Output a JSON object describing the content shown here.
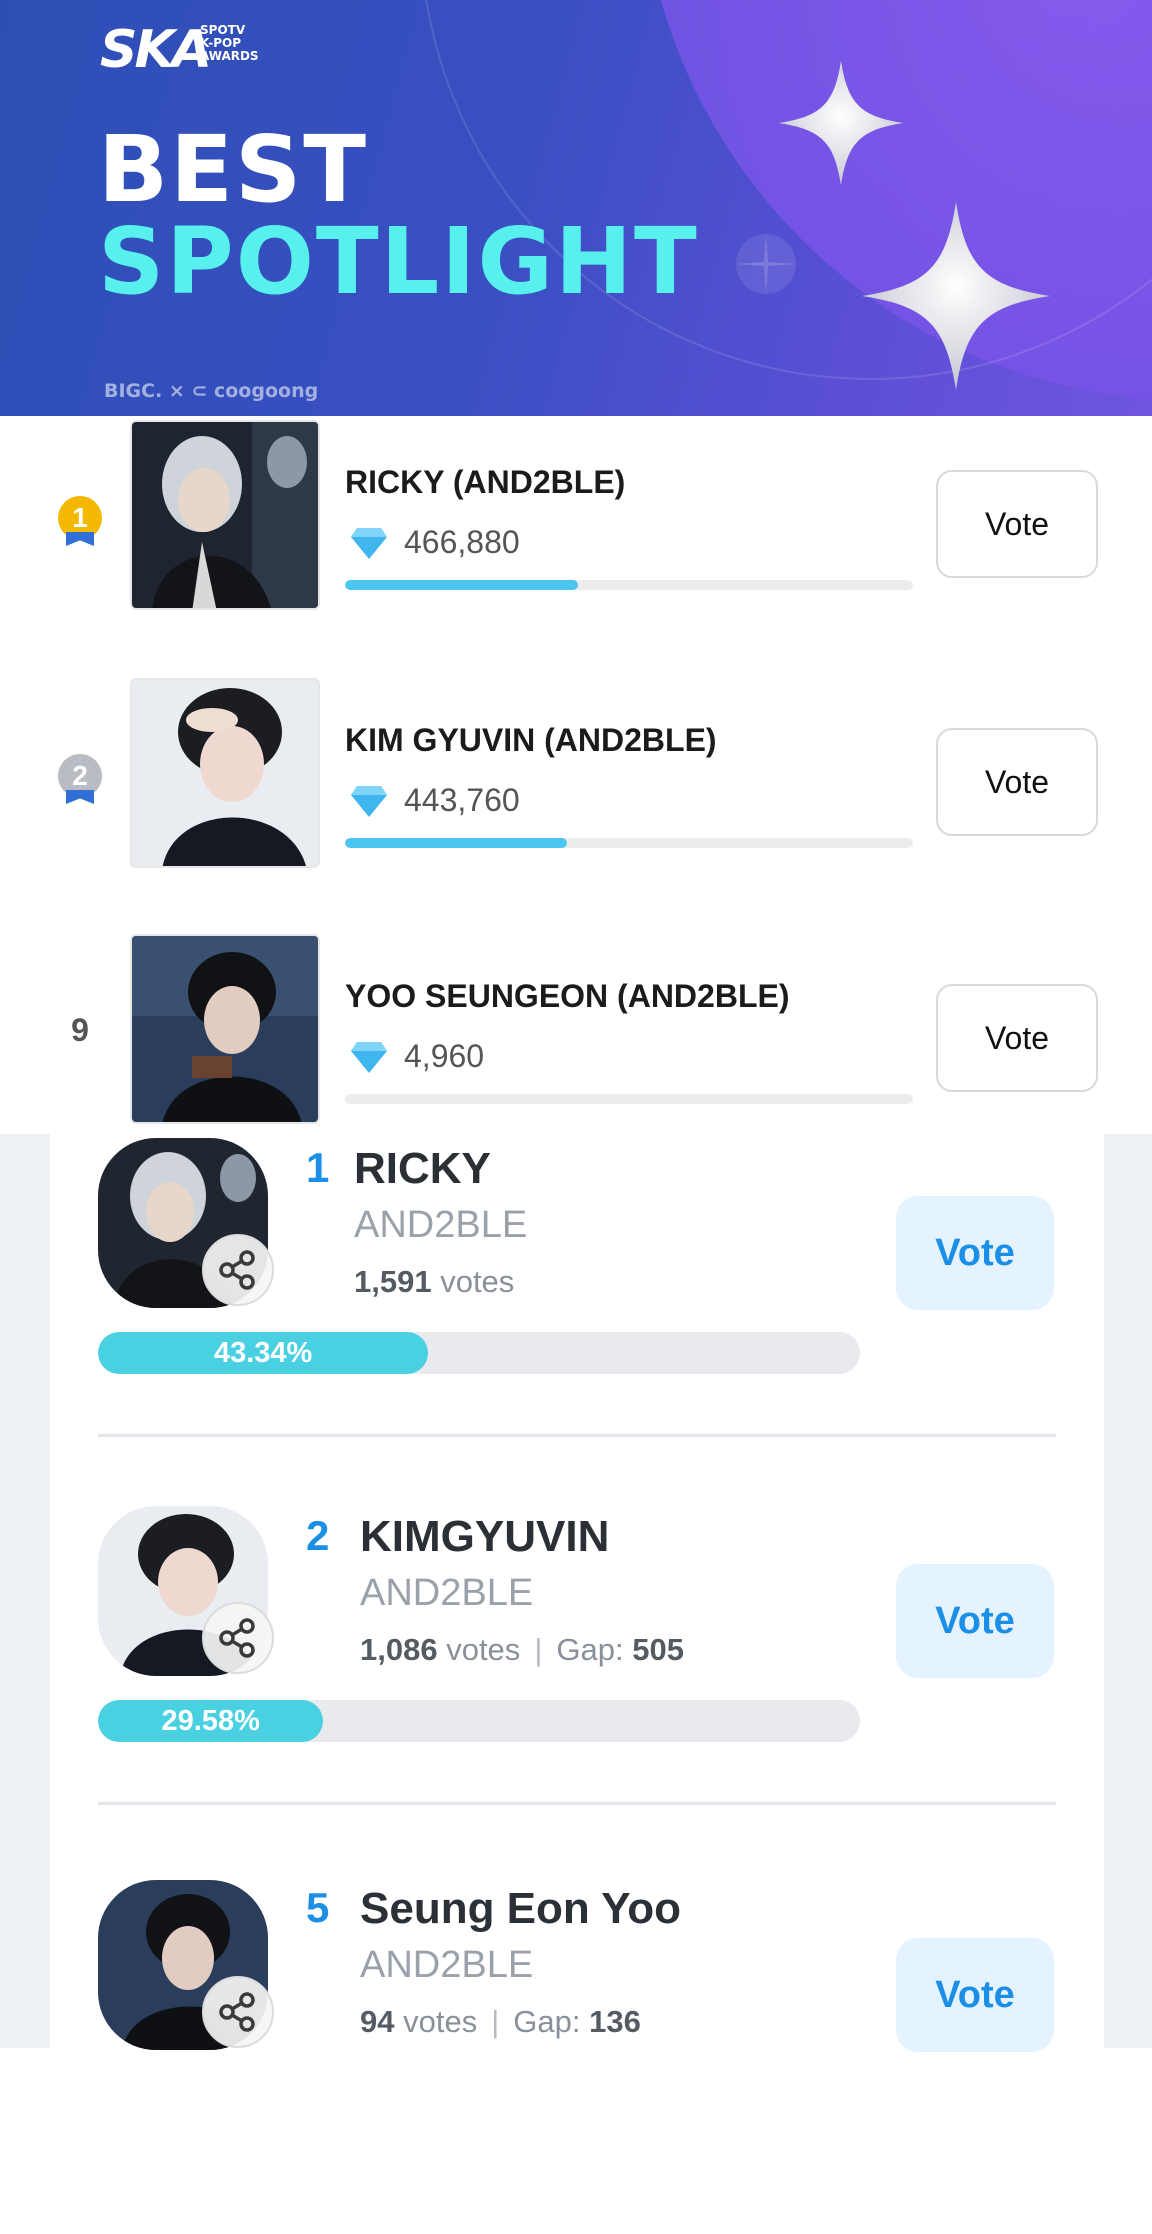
{
  "banner": {
    "logo": "SKA",
    "logo_sub_1": "SPOTV",
    "logo_sub_2": "K-POP",
    "logo_sub_3": "AWARDS",
    "title_line1": "BEST",
    "title_line2": "SPOTLIGHT",
    "partner": "BIGC. × ⊂ coogoong",
    "colors": {
      "title_accent": "#57f0ec",
      "background": "#3a4fc2"
    }
  },
  "list_a": {
    "vote_label": "Vote",
    "items": [
      {
        "rank": "1",
        "name": "RICKY (AND2BLE)",
        "count": "466,880",
        "progress": 0.41,
        "medal": "gold"
      },
      {
        "rank": "2",
        "name": "KIM GYUVIN (AND2BLE)",
        "count": "443,760",
        "progress": 0.39,
        "medal": "silver"
      },
      {
        "rank": "9",
        "name": "YOO SEUNGEON (AND2BLE)",
        "count": "4,960",
        "progress": 0.0
      }
    ]
  },
  "list_b": {
    "vote_label": "Vote",
    "items": [
      {
        "rank": "1",
        "name": "RICKY",
        "group": "AND2BLE",
        "votes_num": "1,591",
        "votes_word": "votes",
        "percent": "43.34%",
        "percent_value": 0.4334
      },
      {
        "rank": "2",
        "name": "KIMGYUVIN",
        "group": "AND2BLE",
        "votes_num": "1,086",
        "votes_word": "votes",
        "gap_label": "Gap:",
        "gap_value": "505",
        "percent": "29.58%",
        "percent_value": 0.2958
      },
      {
        "rank": "5",
        "name": "Seung Eon Yoo",
        "group": "AND2BLE",
        "votes_num": "94",
        "votes_word": "votes",
        "gap_label": "Gap:",
        "gap_value": "136"
      }
    ]
  },
  "icons": {
    "medal": "medal-icon",
    "gem": "diamond-icon",
    "share": "share-icon",
    "sparkle": "sparkle-icon"
  }
}
